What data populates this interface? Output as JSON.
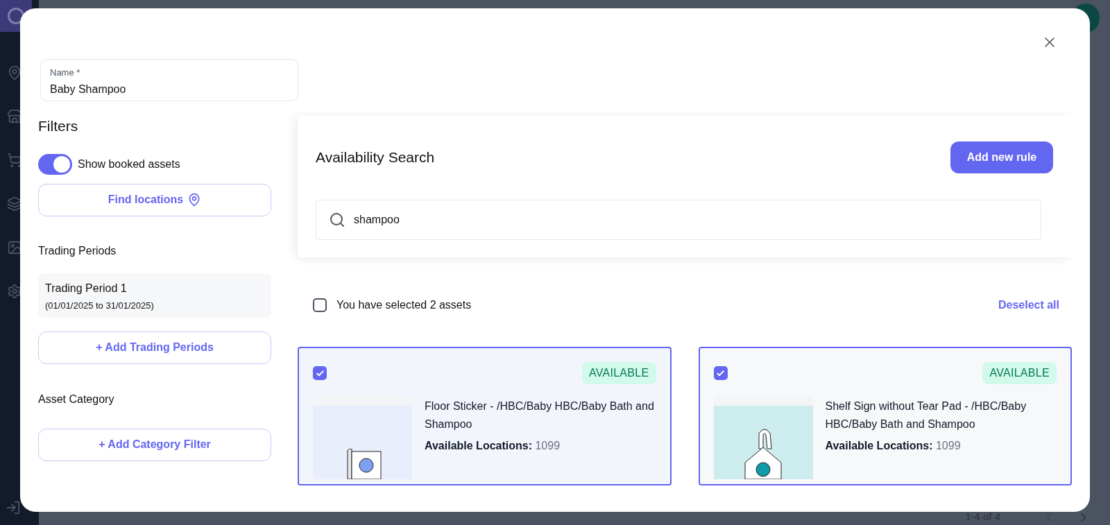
{
  "background": {
    "pagination": "1-4 of 4"
  },
  "modal": {
    "name_field": {
      "label": "Name *",
      "value": "Baby Shampoo"
    },
    "filters": {
      "title": "Filters",
      "toggle": {
        "label": "Show booked assets",
        "on": true
      },
      "find_button": "Find locations",
      "trading_periods": {
        "title": "Trading Periods",
        "items": [
          {
            "name": "Trading Period 1",
            "range": "(01/01/2025 to 31/01/2025)"
          }
        ],
        "add_button": "+ Add Trading Periods"
      },
      "asset_category": {
        "title": "Asset Category",
        "add_button": "+ Add Category Filter"
      }
    },
    "search_panel": {
      "title": "Availability Search",
      "add_button": "Add new rule",
      "search": {
        "value": "shampoo"
      }
    },
    "selection": {
      "checked": false,
      "label": "You have selected 2 assets",
      "deselect": "Deselect all"
    },
    "assets": [
      {
        "kind": "sticker",
        "selected": true,
        "status": "AVAILABLE",
        "title": "Floor Sticker - /HBC/Baby HBC/Baby Bath and Shampoo",
        "locations_label": "Available Locations:",
        "locations": "1099"
      },
      {
        "kind": "hanger",
        "selected": true,
        "status": "AVAILABLE",
        "title": "Shelf Sign without Tear Pad - /HBC/Baby HBC/Baby Bath and Shampoo",
        "locations_label": "Available Locations:",
        "locations": "1099"
      }
    ]
  }
}
